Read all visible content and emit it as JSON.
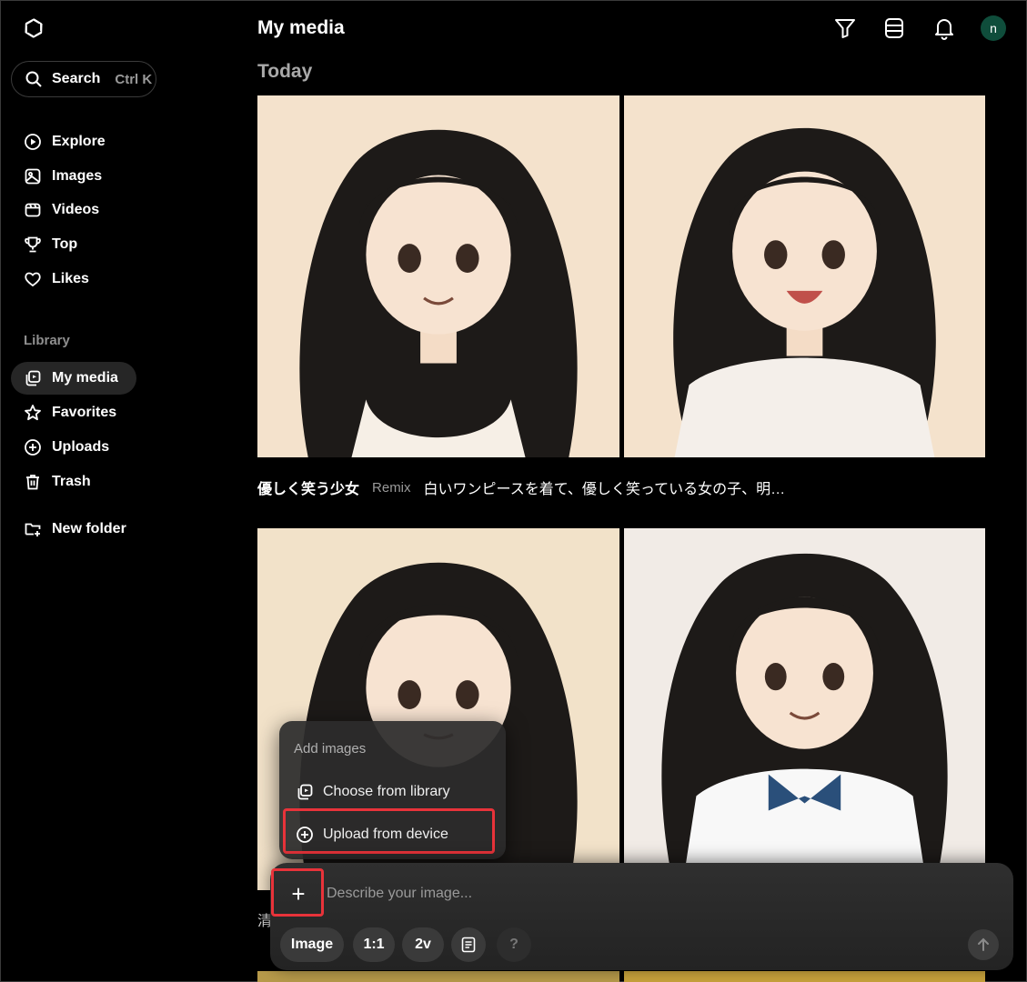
{
  "sidebar": {
    "search_label": "Search",
    "search_shortcut": "Ctrl K",
    "nav": [
      {
        "label": "Explore",
        "icon": "explore-icon"
      },
      {
        "label": "Images",
        "icon": "images-icon"
      },
      {
        "label": "Videos",
        "icon": "videos-icon"
      },
      {
        "label": "Top",
        "icon": "trophy-icon"
      },
      {
        "label": "Likes",
        "icon": "heart-icon"
      }
    ],
    "library_label": "Library",
    "library": [
      {
        "label": "My media",
        "icon": "my-media-icon",
        "active": true
      },
      {
        "label": "Favorites",
        "icon": "star-icon"
      },
      {
        "label": "Uploads",
        "icon": "upload-icon"
      },
      {
        "label": "Trash",
        "icon": "trash-icon"
      }
    ],
    "new_folder_label": "New folder"
  },
  "header": {
    "title": "My media",
    "icons": [
      "filter-icon",
      "view-toggle-icon",
      "bell-icon"
    ],
    "avatar_letter": "n",
    "avatar_color": "#0f4d3b"
  },
  "main": {
    "section_title": "Today",
    "group1": {
      "title": "優しく笑う少女",
      "tag": "Remix",
      "prompt": "白いワンピースを着て、優しく笑っている女の子、明…"
    },
    "peek_char": "清"
  },
  "popup": {
    "heading": "Add images",
    "choose_label": "Choose from library",
    "upload_label": "Upload from device"
  },
  "composer": {
    "placeholder": "Describe your image...",
    "plus_label": "+",
    "mode_label": "Image",
    "ratio_label": "1:1",
    "variants_label": "2v",
    "help_label": "?"
  },
  "colors": {
    "background": "#000000",
    "highlight": "#e8333a"
  }
}
